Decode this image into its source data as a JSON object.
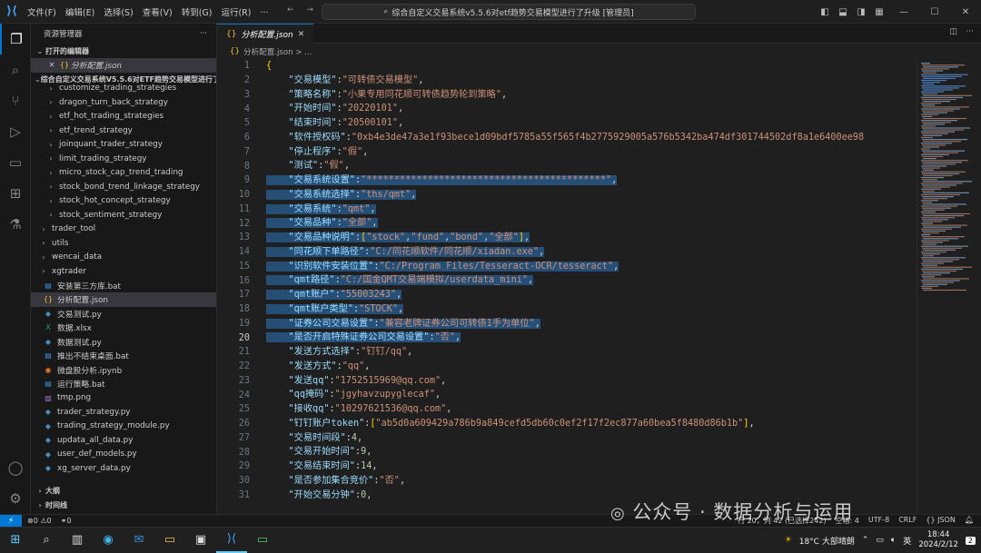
{
  "menu": [
    "文件(F)",
    "编辑(E)",
    "选择(S)",
    "查看(V)",
    "转到(G)",
    "运行(R)",
    "..."
  ],
  "search_text": "综合自定义交易系统v5.5.6对etf趋势交易模型进行了升级 [管理员]",
  "explorer": {
    "title": "资源管理器",
    "more": "···",
    "open_editors_label": "打开的编辑器",
    "open_editor_file": "分析配置.json",
    "project_label": "综合自定义交易系统V5.5.6对ETF趋势交易模型进行了...",
    "tree": [
      {
        "label": "customize_trading_strategies",
        "indent": 2,
        "kind": "folder",
        "open": false
      },
      {
        "label": "dragon_turn_back_strategy",
        "indent": 2,
        "kind": "folder",
        "open": false
      },
      {
        "label": "etf_hot_trading_strategies",
        "indent": 2,
        "kind": "folder",
        "open": false
      },
      {
        "label": "etf_trend_strategy",
        "indent": 2,
        "kind": "folder",
        "open": false
      },
      {
        "label": "joinquant_trader_strategy",
        "indent": 2,
        "kind": "folder",
        "open": false
      },
      {
        "label": "limit_trading_strategy",
        "indent": 2,
        "kind": "folder",
        "open": false
      },
      {
        "label": "micro_stock_cap_trend_trading",
        "indent": 2,
        "kind": "folder",
        "open": false
      },
      {
        "label": "stock_bond_trend_linkage_strategy",
        "indent": 2,
        "kind": "folder",
        "open": false
      },
      {
        "label": "stock_hot_concept_strategy",
        "indent": 2,
        "kind": "folder",
        "open": false
      },
      {
        "label": "stock_sentiment_strategy",
        "indent": 2,
        "kind": "folder",
        "open": false
      },
      {
        "label": "trader_tool",
        "indent": 1,
        "kind": "folder",
        "open": false
      },
      {
        "label": "utils",
        "indent": 1,
        "kind": "folder",
        "open": false
      },
      {
        "label": "wencai_data",
        "indent": 1,
        "kind": "folder",
        "open": false
      },
      {
        "label": "xgtrader",
        "indent": 1,
        "kind": "folder",
        "open": false
      },
      {
        "label": "安装第三方库.bat",
        "indent": 1,
        "kind": "bat"
      },
      {
        "label": "分析配置.json",
        "indent": 1,
        "kind": "json",
        "selected": true
      },
      {
        "label": "交易测试.py",
        "indent": 1,
        "kind": "py"
      },
      {
        "label": "数据.xlsx",
        "indent": 1,
        "kind": "xlsx"
      },
      {
        "label": "数据测试.py",
        "indent": 1,
        "kind": "py"
      },
      {
        "label": "推出不结束桌面.bat",
        "indent": 1,
        "kind": "bat"
      },
      {
        "label": "微盘股分析.ipynb",
        "indent": 1,
        "kind": "ipynb"
      },
      {
        "label": "运行策略.bat",
        "indent": 1,
        "kind": "bat"
      },
      {
        "label": "tmp.png",
        "indent": 1,
        "kind": "png"
      },
      {
        "label": "trader_strategy.py",
        "indent": 1,
        "kind": "py"
      },
      {
        "label": "trading_strategy_module.py",
        "indent": 1,
        "kind": "py"
      },
      {
        "label": "updata_all_data.py",
        "indent": 1,
        "kind": "py"
      },
      {
        "label": "user_def_models.py",
        "indent": 1,
        "kind": "py"
      },
      {
        "label": "xg_server_data.py",
        "indent": 1,
        "kind": "py"
      }
    ],
    "outline_label": "大纲",
    "timeline_label": "时间线"
  },
  "tab_label": "分析配置.json",
  "breadcrumb": "分析配置.json > ...",
  "current_line": 20,
  "code_lines": [
    {
      "n": 1,
      "t": "{",
      "hl": false
    },
    {
      "n": 2,
      "k": "\"交易模型\"",
      "v": "\"可转债交易模型\"",
      "hl": false
    },
    {
      "n": 3,
      "k": "\"策略名称\"",
      "v": "\"小果专用同花顺可转债趋势轮到策略\"",
      "hl": false
    },
    {
      "n": 4,
      "k": "\"开始时间\"",
      "v": "\"20220101\"",
      "hl": false
    },
    {
      "n": 5,
      "k": "\"结束时间\"",
      "v": "\"20500101\"",
      "hl": false
    },
    {
      "n": 6,
      "k": "\"软件授权码\"",
      "v": "\"0xb4e3de47a3e1f93bece1d09bdf5785a55f565f4b2775929005a576b5342ba474df301744502df8a1e6400ee98",
      "hl": false,
      "noComma": true
    },
    {
      "n": 7,
      "k": "\"停止程序\"",
      "v": "\"假\"",
      "hl": false
    },
    {
      "n": 8,
      "k": "\"测试\"",
      "v": "\"假\"",
      "hl": false
    },
    {
      "n": 9,
      "k": "\"交易系统设置\"",
      "v": "\"*******************************************\"",
      "hl": true
    },
    {
      "n": 10,
      "k": "\"交易系统选择\"",
      "v": "\"ths/qmt\"",
      "hl": true
    },
    {
      "n": 11,
      "k": "\"交易系统\"",
      "v": "\"qmt\"",
      "hl": true
    },
    {
      "n": 12,
      "k": "\"交易品种\"",
      "v": "\"全部\"",
      "hl": true
    },
    {
      "n": 13,
      "k": "\"交易品种说明\"",
      "arr": [
        "\"stock\"",
        "\"fund\"",
        "\"bond\"",
        "\"全部\""
      ],
      "hl": true
    },
    {
      "n": 14,
      "k": "\"同花顺下单路径\"",
      "v": "\"C:/同花顺软件/同花顺/xiadan.exe\"",
      "hl": true
    },
    {
      "n": 15,
      "k": "\"识别软件安装位置\"",
      "v": "\"C:/Program Files/Tesseract-OCR/tesseract\"",
      "hl": true
    },
    {
      "n": 16,
      "k": "\"qmt路径\"",
      "v": "\"C:/国金QMT交易端模拟/userdata_mini\"",
      "hl": true
    },
    {
      "n": 17,
      "k": "\"qmt账户\"",
      "v": "\"55003243\"",
      "hl": true
    },
    {
      "n": 18,
      "k": "\"qmt账户类型\"",
      "v": "\"STOCK\"",
      "hl": true
    },
    {
      "n": 19,
      "k": "\"证券公司交易设置\"",
      "v": "\"兼容老牌证券公司可转债1手为单位\"",
      "hl": true
    },
    {
      "n": 20,
      "k": "\"是否开启特殊证券公司交易设置\"",
      "v": "\"否\"",
      "hl": true
    },
    {
      "n": 21,
      "k": "\"发送方式选择\"",
      "v": "\"钉钉/qq\"",
      "hl": false
    },
    {
      "n": 22,
      "k": "\"发送方式\"",
      "v": "\"qq\"",
      "hl": false
    },
    {
      "n": 23,
      "k": "\"发送qq\"",
      "v": "\"1752515969@qq.com\"",
      "hl": false
    },
    {
      "n": 24,
      "k": "\"qq掩码\"",
      "v": "\"jgyhavzupyglecaf\"",
      "hl": false
    },
    {
      "n": 25,
      "k": "\"接收qq\"",
      "v": "\"10297621536@qq.com\"",
      "hl": false
    },
    {
      "n": 26,
      "k": "\"钉钉账户token\"",
      "arr": [
        "\"ab5d0a609429a786b9a849cefd5db60c0ef2f17f2ec877a60bea5f8480d86b1b\""
      ],
      "hl": false
    },
    {
      "n": 27,
      "k": "\"交易时间段\"",
      "num": "4",
      "hl": false
    },
    {
      "n": 28,
      "k": "\"交易开始时间\"",
      "num": "9",
      "hl": false
    },
    {
      "n": 29,
      "k": "\"交易结束时间\"",
      "num": "14",
      "hl": false
    },
    {
      "n": 30,
      "k": "\"是否参加集合竞价\"",
      "v": "\"否\"",
      "hl": false
    },
    {
      "n": 31,
      "k": "\"开始交易分钟\"",
      "num": "0",
      "hl": false
    }
  ],
  "status": {
    "errors": "⊗0 ⚠0",
    "ports": "⚭0",
    "position": "行 20，列 42 (已选择242)",
    "spaces": "空格: 4",
    "encoding": "UTF-8",
    "eol": "CRLF",
    "language": "{} JSON"
  },
  "taskbar": {
    "weather": "18°C  大部晴朗",
    "lang": "英",
    "time": "18:44",
    "date": "2024/2/12",
    "notif": "2"
  },
  "watermark": "公众号 · 数据分析与运用"
}
